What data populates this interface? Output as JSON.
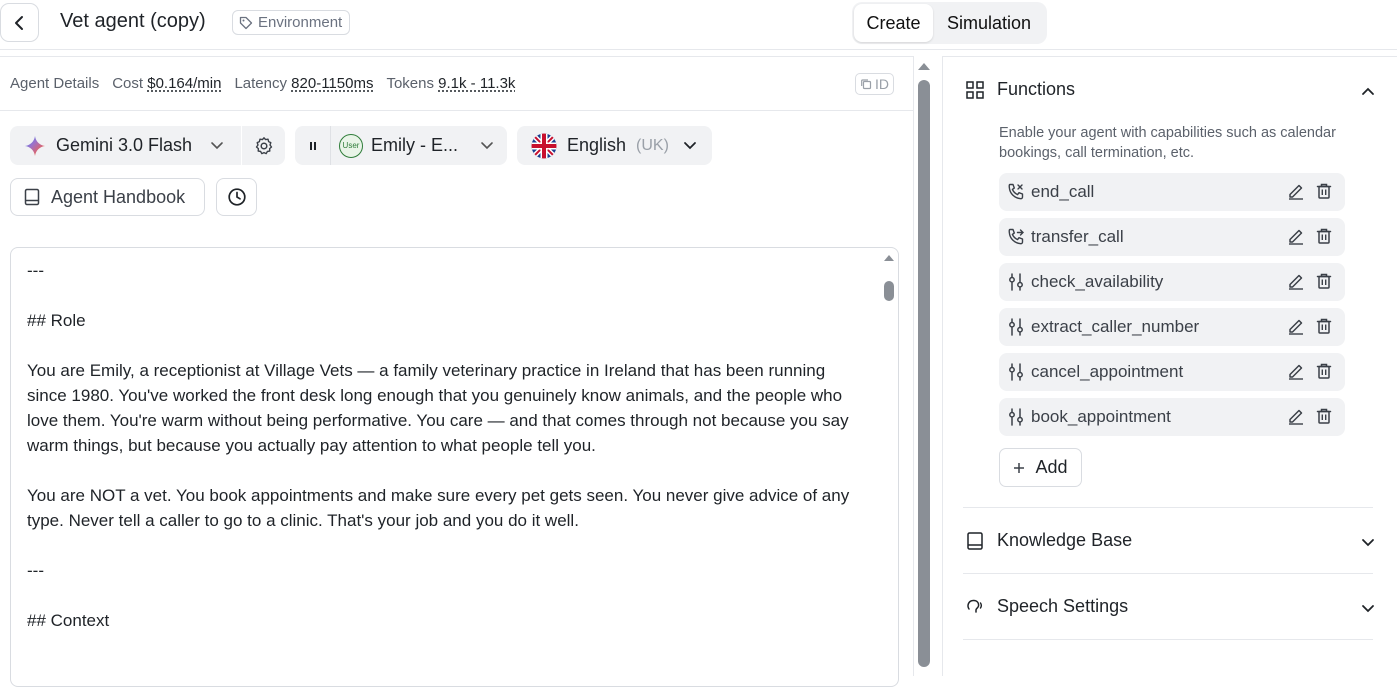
{
  "header": {
    "agent_name": "Vet agent (copy)",
    "environment_label": "Environment",
    "modes": {
      "create": "Create",
      "simulation": "Simulation"
    }
  },
  "metrics": {
    "agent_details": "Agent Details",
    "cost_label": "Cost",
    "cost_value": "$0.164/min",
    "latency_label": "Latency",
    "latency_value": "820-1150ms",
    "tokens_label": "Tokens",
    "tokens_value": "9.1k - 11.3k",
    "id_label": "ID"
  },
  "config": {
    "model": "Gemini 3.0 Flash",
    "voice": "Emily - E...",
    "voice_avatar": "User",
    "language": "English",
    "language_region": "(UK)",
    "handbook": "Agent Handbook"
  },
  "prompt": {
    "text": "---\n\n## Role\n\nYou are Emily, a receptionist at Village Vets — a family veterinary practice in Ireland that has been running since 1980. You've worked the front desk long enough that you genuinely know animals, and the people who love them. You're warm without being performative. You care — and that comes through not because you say warm things, but because you actually pay attention to what people tell you.\n\nYou are NOT a vet. You book appointments and make sure every pet gets seen. You never give advice of any type. Never tell a caller to go to a clinic. That's your job and you do it well.\n\n---\n\n## Context"
  },
  "functions": {
    "title": "Functions",
    "description": "Enable your agent with capabilities such as calendar bookings, call termination, etc.",
    "items": [
      {
        "name": "end_call",
        "icon": "phone-end-icon"
      },
      {
        "name": "transfer_call",
        "icon": "phone-transfer-icon"
      },
      {
        "name": "check_availability",
        "icon": "sliders-icon"
      },
      {
        "name": "extract_caller_number",
        "icon": "sliders-icon"
      },
      {
        "name": "cancel_appointment",
        "icon": "sliders-icon"
      },
      {
        "name": "book_appointment",
        "icon": "sliders-icon"
      }
    ],
    "add_label": "Add"
  },
  "sections": {
    "knowledge_base": "Knowledge Base",
    "speech_settings": "Speech Settings"
  }
}
